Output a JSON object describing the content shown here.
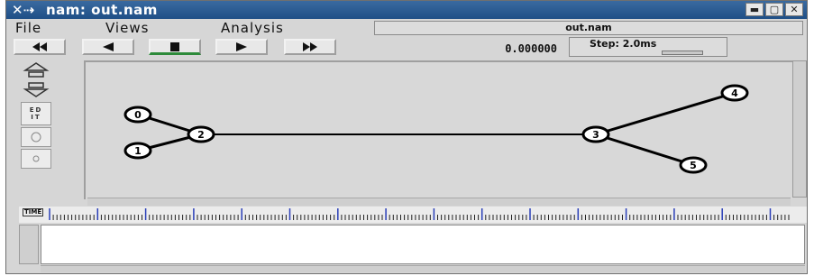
{
  "window": {
    "title": "nam: out.nam",
    "buttons": [
      "minimize",
      "maximize",
      "close"
    ]
  },
  "menu": {
    "items": [
      "File",
      "Views",
      "Analysis"
    ],
    "file_field": "out.nam"
  },
  "controls": {
    "buttons": [
      {
        "name": "rewind",
        "glyph": "◀◀"
      },
      {
        "name": "play-backward",
        "glyph": "◀"
      },
      {
        "name": "stop",
        "glyph": "■"
      },
      {
        "name": "play-forward",
        "glyph": "▶"
      },
      {
        "name": "fast-forward",
        "glyph": "▶▶"
      }
    ],
    "time": "0.000000",
    "step_label": "Step: 2.0ms"
  },
  "tools": {
    "edit_label": "EDIT"
  },
  "topology": {
    "nodes": [
      {
        "id": "0",
        "label": "0"
      },
      {
        "id": "1",
        "label": "1"
      },
      {
        "id": "2",
        "label": "2"
      },
      {
        "id": "3",
        "label": "3"
      },
      {
        "id": "4",
        "label": "4"
      },
      {
        "id": "5",
        "label": "5"
      }
    ],
    "links": [
      {
        "from": "0",
        "to": "2"
      },
      {
        "from": "1",
        "to": "2"
      },
      {
        "from": "2",
        "to": "3"
      },
      {
        "from": "3",
        "to": "4"
      },
      {
        "from": "3",
        "to": "5"
      }
    ]
  },
  "timeline": {
    "label": "TIME"
  },
  "colors": {
    "title_bar": "#1f4f86",
    "timeline_ticks": "#2a3fb8",
    "active_play": "#2d8a3a"
  }
}
